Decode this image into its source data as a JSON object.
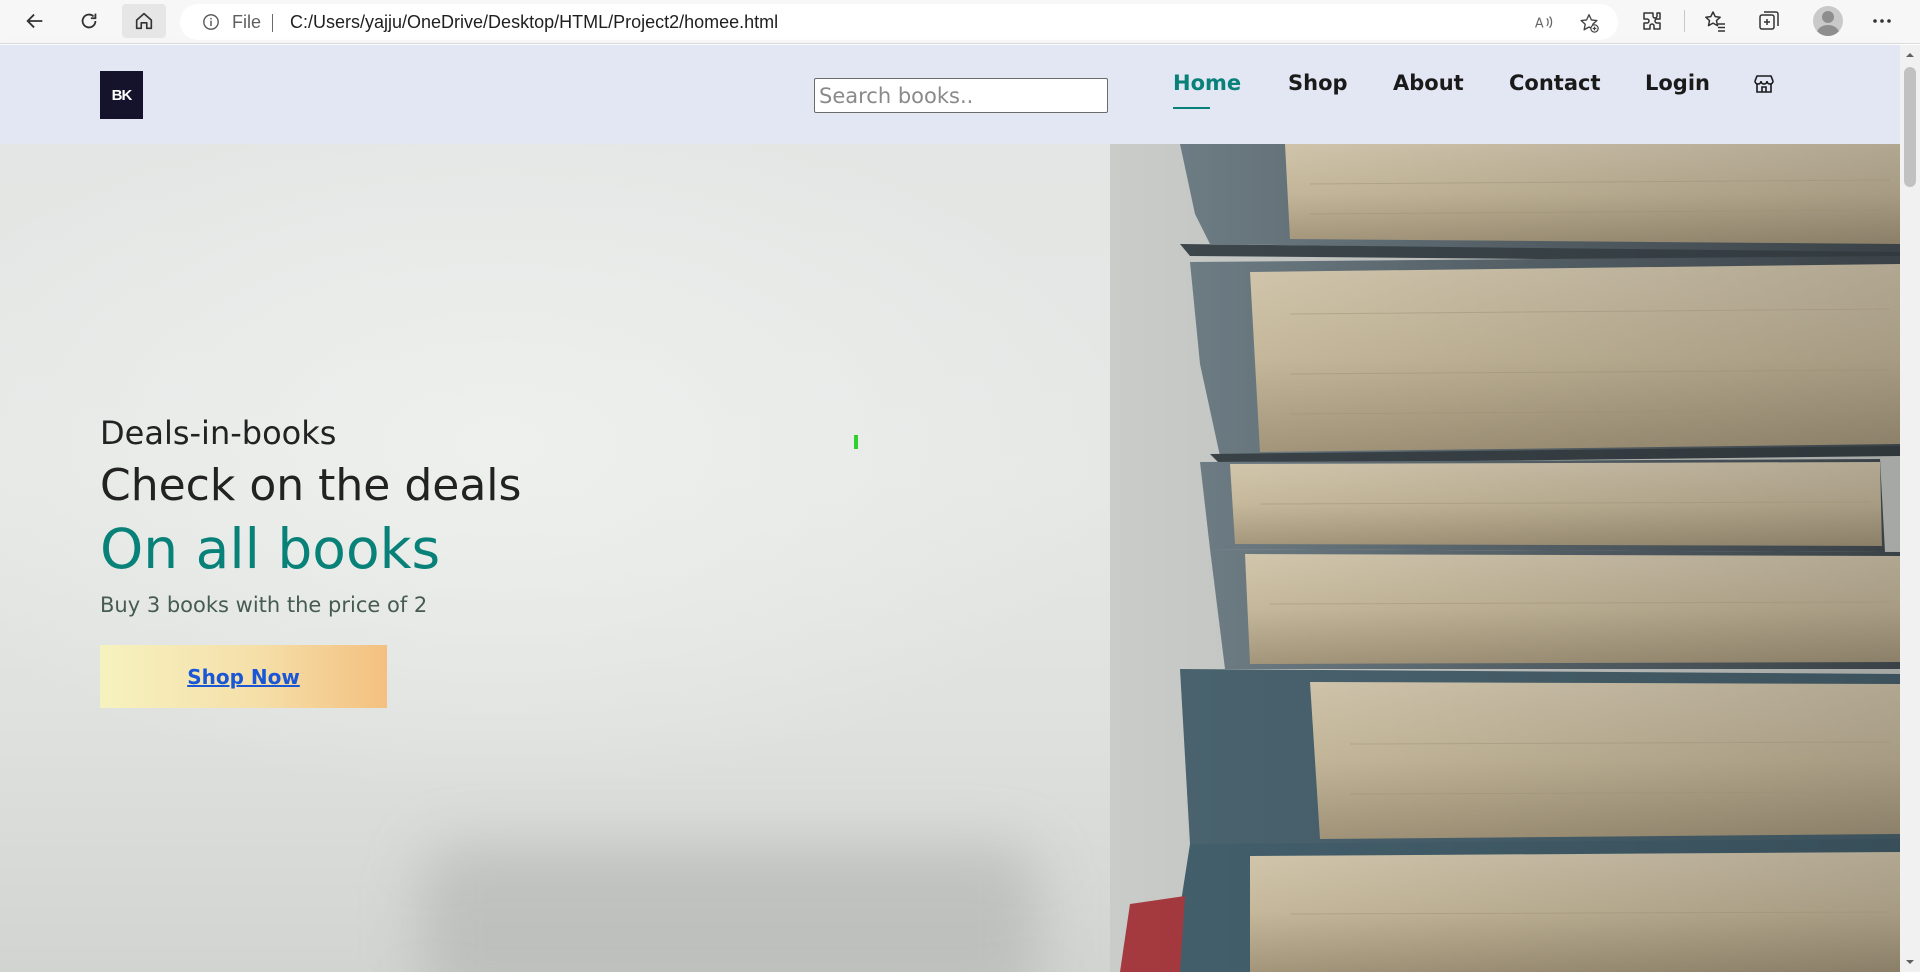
{
  "browser": {
    "file_label": "File",
    "url": "C:/Users/yajju/OneDrive/Desktop/HTML/Project2/homee.html"
  },
  "site": {
    "logo_text": "BK",
    "search": {
      "placeholder": "Search books..",
      "value": ""
    },
    "nav": [
      {
        "label": "Home",
        "active": true
      },
      {
        "label": "Shop",
        "active": false
      },
      {
        "label": "About",
        "active": false
      },
      {
        "label": "Contact",
        "active": false
      },
      {
        "label": "Login",
        "active": false
      }
    ]
  },
  "hero": {
    "eyebrow": "Deals-in-books",
    "subheading": "Check on the deals",
    "heading": "On all books",
    "tagline": "Buy 3 books with the price of 2",
    "cta_label": "Shop Now"
  },
  "colors": {
    "accent": "#088178",
    "header_bg": "#e3e6f3",
    "cta_link": "#1a57d6"
  }
}
